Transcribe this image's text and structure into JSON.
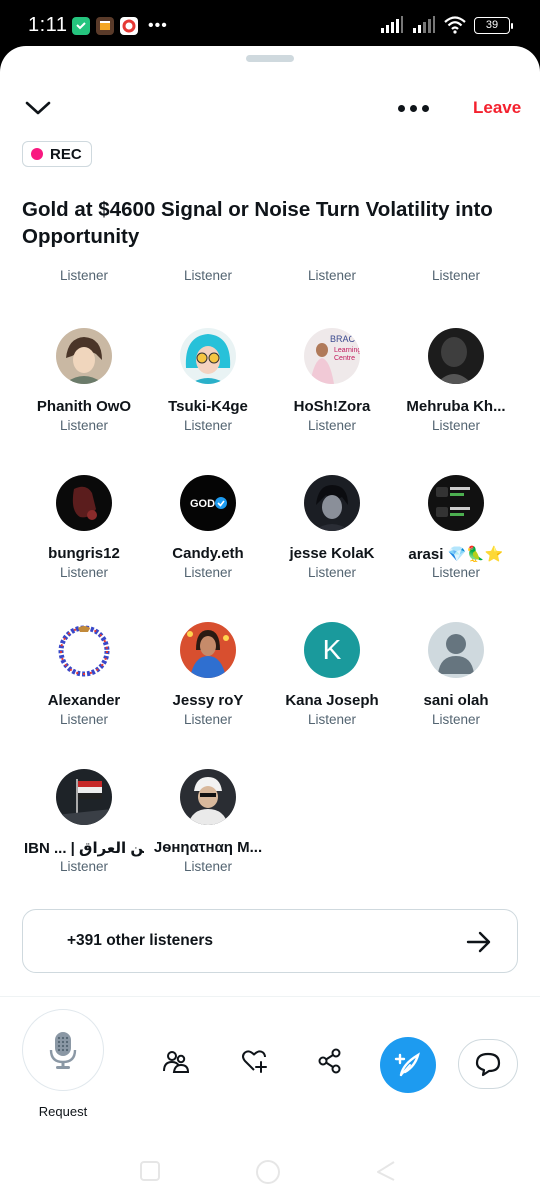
{
  "status_bar": {
    "time": "1:11",
    "overflow": "•••",
    "battery": "39"
  },
  "header": {
    "leave_label": "Leave",
    "rec_label": "REC"
  },
  "space": {
    "title": "Gold at $4600 Signal or Noise Turn Volatility into Opportunity"
  },
  "partial_row": {
    "roles": [
      "Listener",
      "Listener",
      "Listener",
      "Listener"
    ]
  },
  "listeners": [
    {
      "name": "Phanith OwO",
      "role": "Listener",
      "avatar": "anime-boy"
    },
    {
      "name": "Tsuki-K4ge",
      "role": "Listener",
      "avatar": "blue-hair-girl"
    },
    {
      "name": "HoSh!Zora",
      "role": "Listener",
      "avatar": "brac-learning-centre"
    },
    {
      "name": "Mehruba Kh...",
      "role": "Listener",
      "avatar": "dark-portrait"
    },
    {
      "name": "bungris12",
      "role": "Listener",
      "avatar": "dark-figure"
    },
    {
      "name": "Candy.eth",
      "role": "Listener",
      "avatar": "god-verified"
    },
    {
      "name": "jesse KolaK",
      "role": "Listener",
      "avatar": "anime-dark"
    },
    {
      "name": "arasi 💎🦜⭐",
      "role": "Listener",
      "avatar": "crypto-ticker"
    },
    {
      "name": "Alexander",
      "role": "Listener",
      "avatar": "beaded-ring"
    },
    {
      "name": "Jessy roY",
      "role": "Listener",
      "avatar": "woman-blue-dress"
    },
    {
      "name": "Kana Joseph",
      "role": "Listener",
      "avatar": "letter-k",
      "initial": "K"
    },
    {
      "name": "sani olah",
      "role": "Listener",
      "avatar": "default-person"
    },
    {
      "name": "IBN ... | ابن العراق",
      "role": "Listener",
      "avatar": "iraq-flag"
    },
    {
      "name": "Jѳнηατнαη M...",
      "role": "Listener",
      "avatar": "man-white-cap"
    }
  ],
  "other_listeners": {
    "label": "+391 other listeners"
  },
  "bottom_bar": {
    "request_label": "Request"
  },
  "colors": {
    "leave": "#f4212e",
    "rec_dot": "#f91880",
    "compose": "#1d9bf0",
    "kana_avatar": "#1a9a9c"
  }
}
